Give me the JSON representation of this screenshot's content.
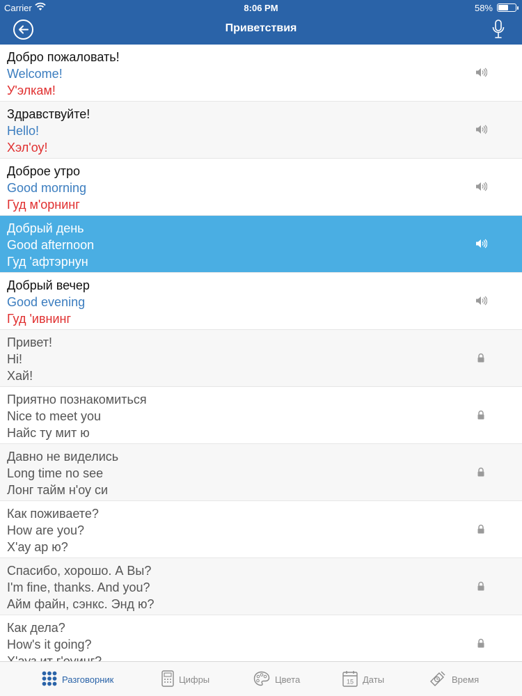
{
  "status": {
    "carrier": "Carrier",
    "time": "8:06 PM",
    "battery": "58%",
    "battery_level": 0.58
  },
  "header": {
    "title": "Приветствия",
    "back_icon": "back-arrow-icon",
    "mic_icon": "microphone-icon"
  },
  "colors": {
    "header_bg": "#2a63a8",
    "selected_bg": "#4aaee3",
    "english": "#3b7dbf",
    "transcription": "#e03030",
    "tab_active": "#2a63a8"
  },
  "phrases": [
    {
      "ru": "Добро пожаловать!",
      "en": "Welcome!",
      "tr": "У'элкам!",
      "icon": "speaker-icon",
      "state": "unlocked"
    },
    {
      "ru": "Здравствуйте!",
      "en": "Hello!",
      "tr": "Хэл'оу!",
      "icon": "speaker-icon",
      "state": "unlocked"
    },
    {
      "ru": "Доброе утро",
      "en": "Good morning",
      "tr": "Гуд м'орнинг",
      "icon": "speaker-icon",
      "state": "unlocked"
    },
    {
      "ru": "Добрый день",
      "en": "Good afternoon",
      "tr": "Гуд 'афтэрнун",
      "icon": "speaker-icon",
      "state": "selected"
    },
    {
      "ru": "Добрый вечер",
      "en": "Good evening",
      "tr": "Гуд 'ивнинг",
      "icon": "speaker-icon",
      "state": "unlocked"
    },
    {
      "ru": "Привет!",
      "en": "Hi!",
      "tr": "Хай!",
      "icon": "lock-icon",
      "state": "locked"
    },
    {
      "ru": "Приятно познакомиться",
      "en": "Nice to meet you",
      "tr": "Найс ту мит ю",
      "icon": "lock-icon",
      "state": "locked"
    },
    {
      "ru": "Давно не виделись",
      "en": "Long time no see",
      "tr": "Лонг тайм н'оу си",
      "icon": "lock-icon",
      "state": "locked"
    },
    {
      "ru": "Как поживаете?",
      "en": "How are you?",
      "tr": "Х'ау ар ю?",
      "icon": "lock-icon",
      "state": "locked"
    },
    {
      "ru": "Спасибо, хорошо. А Вы?",
      "en": "I'm fine, thanks. And you?",
      "tr": "Айм файн, сэнкс. Энд ю?",
      "icon": "lock-icon",
      "state": "locked"
    },
    {
      "ru": "Как дела?",
      "en": "How's it going?",
      "tr": "Х'ауз ит г'оуинг?",
      "icon": "lock-icon",
      "state": "locked"
    }
  ],
  "tabs": [
    {
      "label": "Разговорник",
      "icon": "phrasebook-grid-icon",
      "active": true
    },
    {
      "label": "Цифры",
      "icon": "calculator-icon",
      "active": false
    },
    {
      "label": "Цвета",
      "icon": "palette-icon",
      "active": false
    },
    {
      "label": "Даты",
      "icon": "calendar-icon",
      "active": false,
      "icon_text": "15"
    },
    {
      "label": "Время",
      "icon": "clock-icon",
      "active": false
    }
  ]
}
